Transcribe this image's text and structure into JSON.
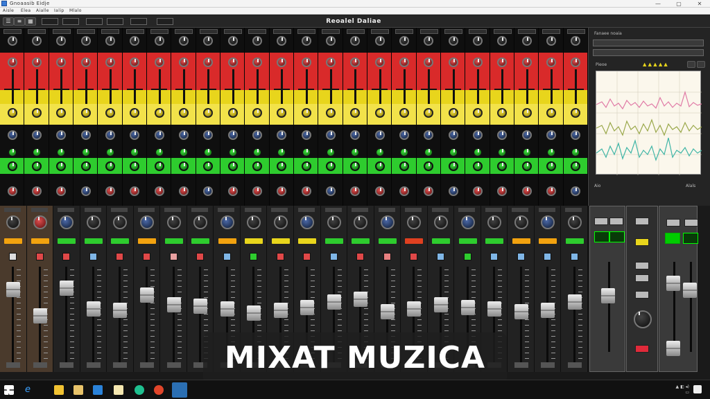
{
  "window": {
    "title": "Gnoaasib Eidje",
    "minimize_glyph": "—",
    "maximize_glyph": "▢",
    "close_glyph": "✕"
  },
  "menu": {
    "items": [
      "Aisle",
      "Elea",
      "Aialle",
      "Ialip",
      "Mlalo"
    ]
  },
  "toolbar": {
    "app_title": "Reoalel Daliae"
  },
  "sidepanel": {
    "title": "Fanaee noaia",
    "scope_label": "Pieoe",
    "footer_left": "Aio",
    "footer_right": "Alals"
  },
  "overlay": {
    "caption": "MIXAT MUZICA"
  },
  "colors": {
    "band_red": "#d92a2a",
    "band_yellow": "#e8d51c",
    "band_green": "#2ecc2e",
    "scope_pink": "#e07aa6",
    "scope_olive": "#9aa84a",
    "scope_teal": "#3fb5a6"
  },
  "icons": [
    "windows-start-icon",
    "edge-browser-icon",
    "file-explorer-icon",
    "store-icon",
    "mail-icon",
    "notes-icon",
    "game-icon",
    "media-icon",
    "browser-icon",
    "notifications-icon"
  ]
}
